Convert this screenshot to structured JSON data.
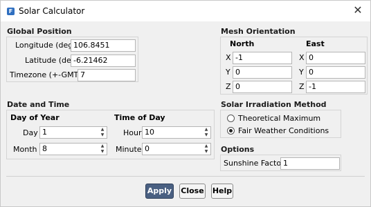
{
  "window": {
    "title": "Solar Calculator",
    "icon_glyph": "F"
  },
  "global_position": {
    "title": "Global Position",
    "longitude_label": "Longitude (deg)",
    "longitude_value": "106.8451",
    "latitude_label": "Latitude (deg)",
    "latitude_value": "-6.21462",
    "timezone_label": "Timezone (+-GMT)",
    "timezone_value": "7"
  },
  "mesh_orientation": {
    "title": "Mesh Orientation",
    "north_label": "North",
    "east_label": "East",
    "north": {
      "x_label": "X",
      "x": "-1",
      "y_label": "Y",
      "y": "0",
      "z_label": "Z",
      "z": "0"
    },
    "east": {
      "x_label": "X",
      "x": "0",
      "y_label": "Y",
      "y": "0",
      "z_label": "Z",
      "z": "-1"
    }
  },
  "date_time": {
    "title": "Date and Time",
    "day_of_year_title": "Day of Year",
    "day_label": "Day",
    "day_value": "1",
    "month_label": "Month",
    "month_value": "8",
    "time_of_day_title": "Time of Day",
    "hour_label": "Hour",
    "hour_value": "10",
    "minute_label": "Minute",
    "minute_value": "0"
  },
  "irradiation": {
    "title": "Solar Irradiation Method",
    "options": [
      "Theoretical Maximum",
      "Fair Weather Conditions"
    ],
    "selected": "Fair Weather Conditions"
  },
  "options": {
    "title": "Options",
    "sunshine_label": "Sunshine Factor",
    "sunshine_value": "1"
  },
  "buttons": {
    "apply": "Apply",
    "close": "Close",
    "help": "Help"
  },
  "colors": {
    "apply_bg": "#4a6082",
    "panel_bg": "#f0f0f0",
    "icon_bg": "#2f6fc0"
  }
}
